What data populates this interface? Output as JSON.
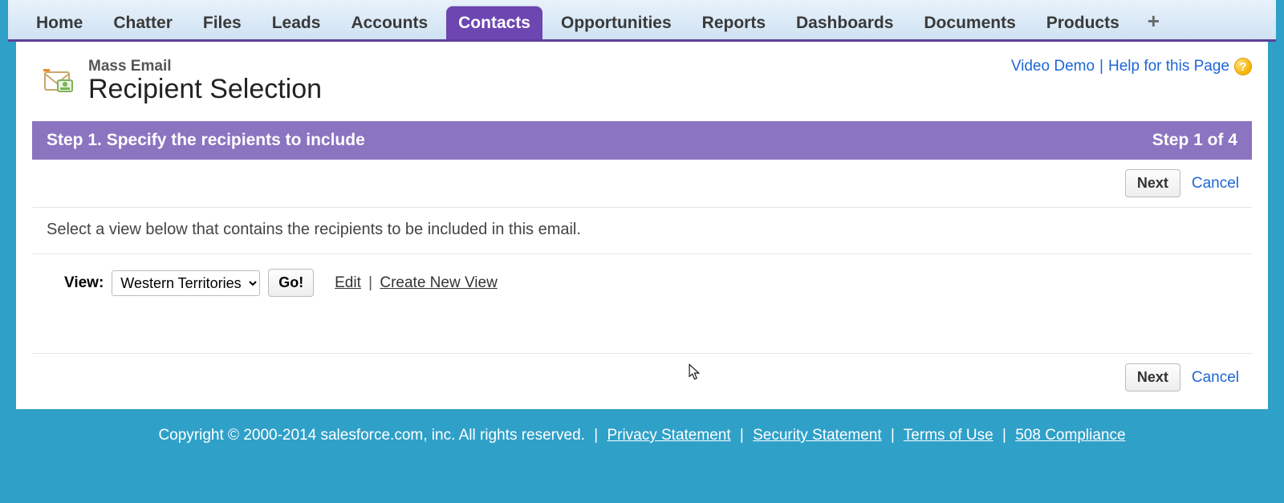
{
  "tabs": {
    "items": [
      {
        "label": "Home"
      },
      {
        "label": "Chatter"
      },
      {
        "label": "Files"
      },
      {
        "label": "Leads"
      },
      {
        "label": "Accounts"
      },
      {
        "label": "Contacts"
      },
      {
        "label": "Opportunities"
      },
      {
        "label": "Reports"
      },
      {
        "label": "Dashboards"
      },
      {
        "label": "Documents"
      },
      {
        "label": "Products"
      }
    ],
    "active_index": 5,
    "add_glyph": "+"
  },
  "header": {
    "subtitle": "Mass Email",
    "title": "Recipient Selection",
    "video_demo": "Video Demo",
    "help_link": "Help for this Page",
    "help_glyph": "?"
  },
  "step": {
    "title": "Step 1. Specify the recipients to include",
    "counter": "Step 1 of 4"
  },
  "actions": {
    "next": "Next",
    "cancel": "Cancel"
  },
  "body": {
    "instructions": "Select a view below that contains the recipients to be included in this email.",
    "view_label": "View:",
    "view_selected": "Western Territories",
    "go": "Go!",
    "edit": "Edit",
    "create_new_view": "Create New View"
  },
  "footer": {
    "copyright": "Copyright © 2000-2014 salesforce.com, inc. All rights reserved.",
    "links": [
      "Privacy Statement",
      "Security Statement",
      "Terms of Use",
      "508 Compliance"
    ]
  }
}
